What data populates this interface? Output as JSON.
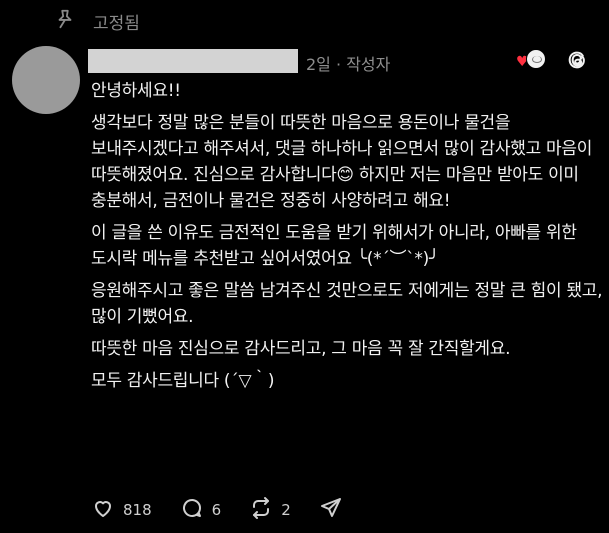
{
  "pinned": {
    "label": "고정됨",
    "icon": "pin-icon"
  },
  "post": {
    "author_name": "",
    "time": "2일",
    "separator": "·",
    "author_tag": "작성자",
    "paragraphs": [
      "안녕하세요!!",
      "생각보다 정말 많은 분들이 따뜻한 마음으로 용돈이나 물건을 보내주시겠다고 해주셔서, 댓글 하나하나 읽으면서 많이 감사했고 마음이 따뜻해졌어요. 진심으로 감사합니다😊 하지만 저는 마음만 받아도 이미 충분해서, 금전이나 물건은 정중히 사양하려고 해요!",
      "이 글을 쓴 이유도 금전적인 도움을 받기 위해서가 아니라, 아빠를 위한 도시락 메뉴를 추천받고 싶어서였어요 ╰(*´︶`*)╯",
      "응원해주시고 좋은 말씀 남겨주신 것만으로도 저에게는 정말 큰 힘이 됐고, 많이 기뻤어요.",
      "따뜻한 마음 진심으로 감사드리고, 그 마음 꼭 잘 간직할게요.",
      "모두 감사드립니다 (´▽｀)"
    ]
  },
  "actions": {
    "likes": "818",
    "replies": "6",
    "reposts": "2"
  },
  "colors": {
    "background": "#000000",
    "text": "#f2f2f2",
    "muted": "#8e8e8e",
    "heart": "#ff3040"
  }
}
